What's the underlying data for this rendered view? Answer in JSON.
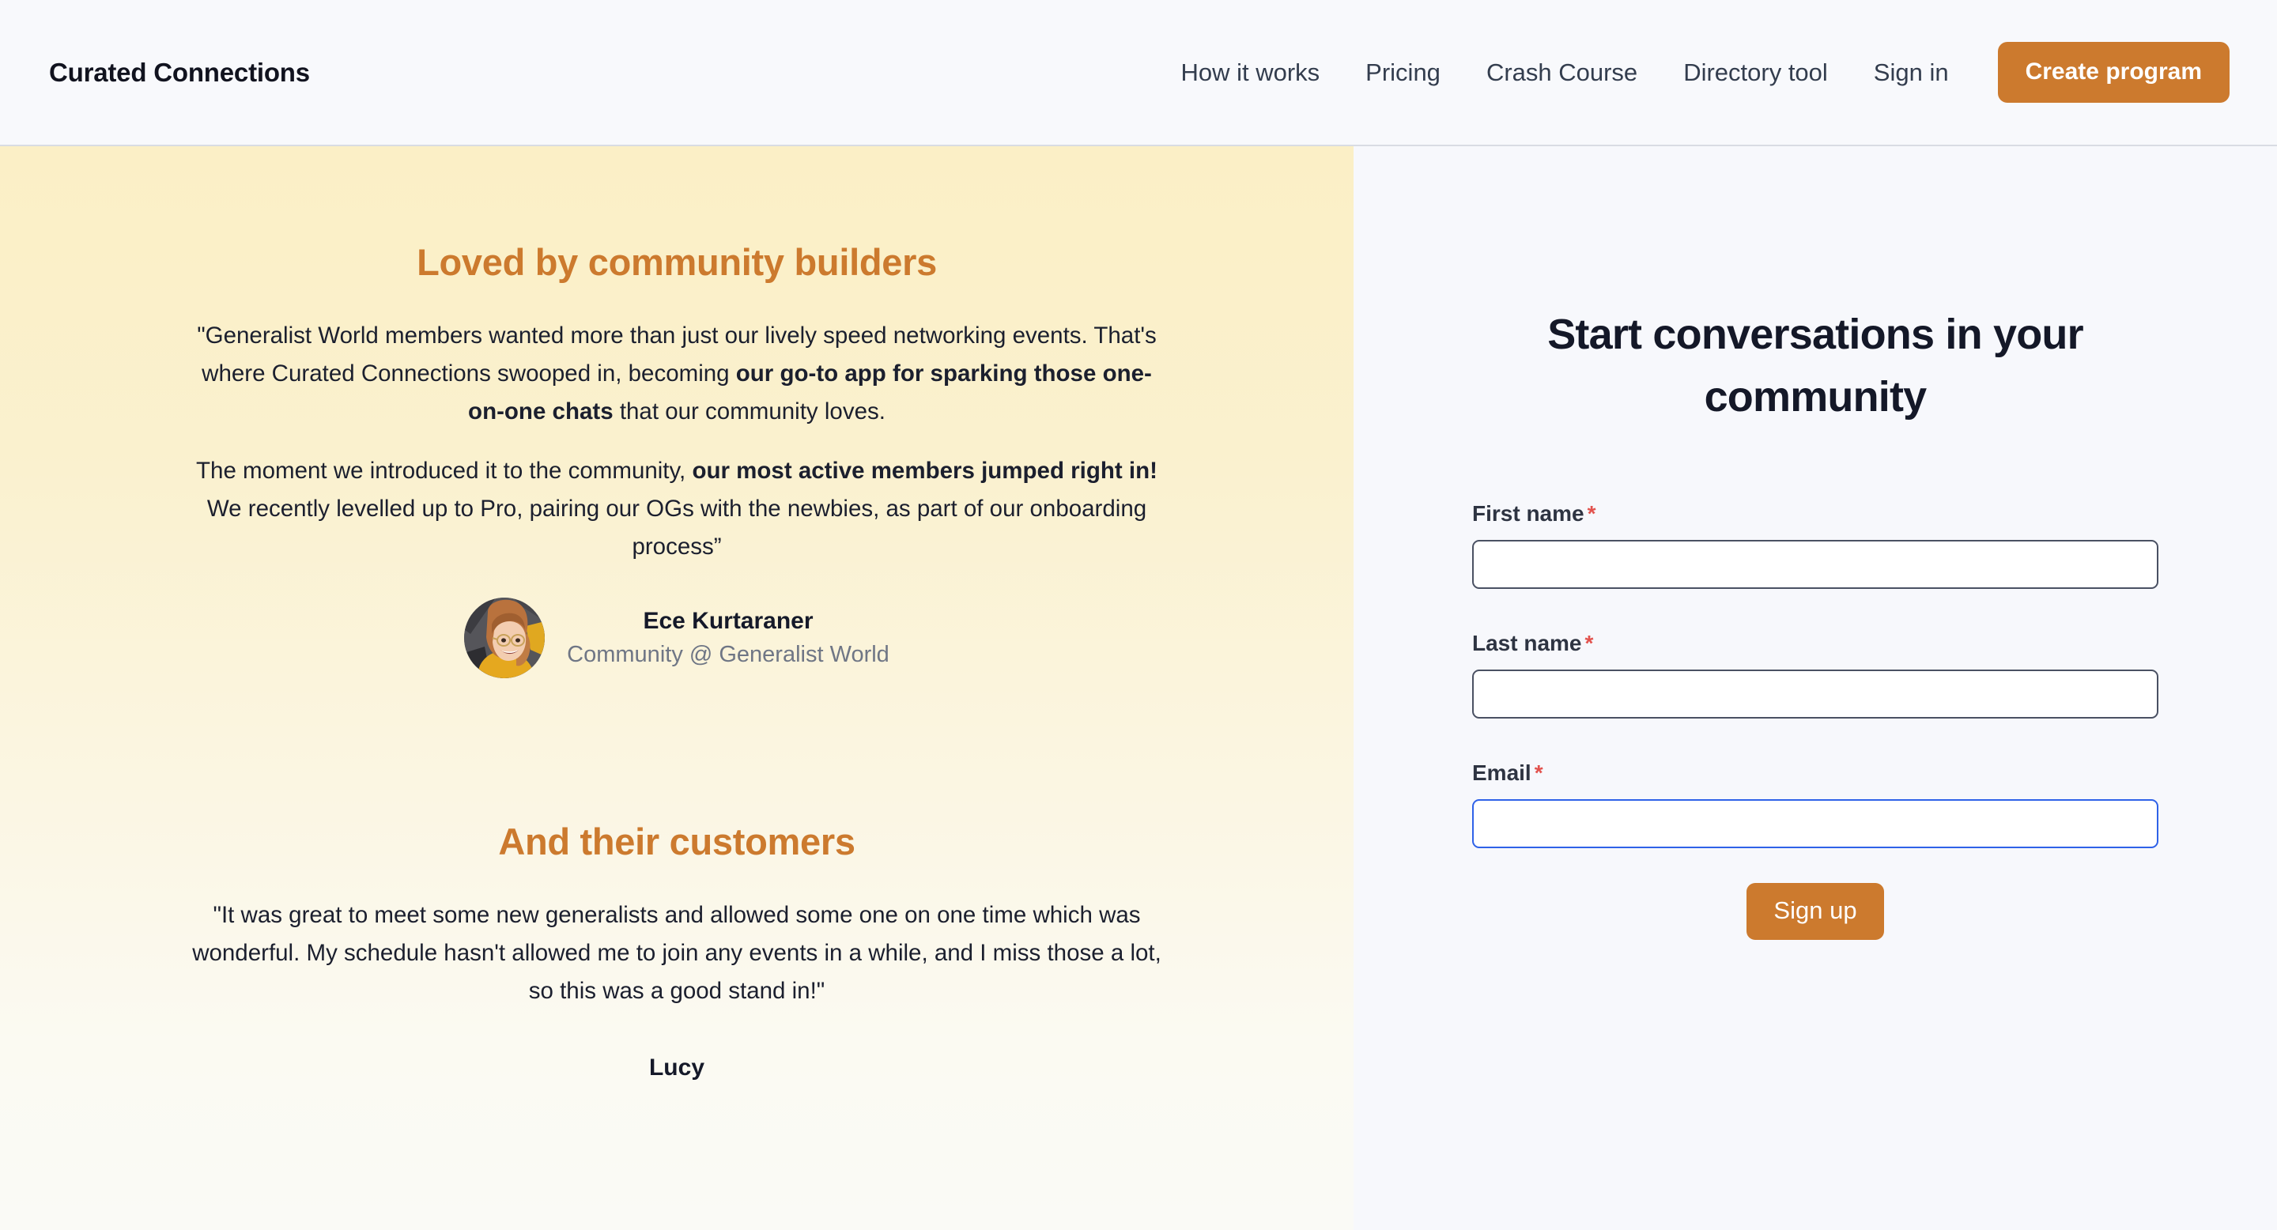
{
  "header": {
    "brand": "Curated Connections",
    "nav": [
      {
        "label": "How it works"
      },
      {
        "label": "Pricing"
      },
      {
        "label": "Crash Course"
      },
      {
        "label": "Directory tool"
      },
      {
        "label": "Sign in"
      }
    ],
    "cta_label": "Create program"
  },
  "testimonials": {
    "title": "Loved by community builders",
    "quote_p1_a": "\"Generalist World members wanted more than just our lively speed networking events. That's where Curated Connections swooped in, becoming ",
    "quote_p1_bold": "our go-to app for sparking those one-on-one chats",
    "quote_p1_b": " that our community loves.",
    "quote_p2_a": "The moment we introduced it to the community, ",
    "quote_p2_bold": "our most active members jumped right in!",
    "quote_p2_b": " We recently levelled up to Pro, pairing our OGs with the newbies, as part of our onboarding process”",
    "author_name": "Ece Kurtaraner",
    "author_role": "Community @ Generalist World",
    "avatar_name": "ece-kurtaraner-photo"
  },
  "customers": {
    "title": "And their customers",
    "quote": "\"It was great to meet some new generalists and allowed some one on one time which was wonderful. My schedule hasn't allowed me to join any events in a while, and I miss those a lot, so this was a good stand in!\"",
    "name": "Lucy"
  },
  "signup": {
    "title": "Start conversations in your community",
    "fields": [
      {
        "label": "First name",
        "required": "*",
        "value": "",
        "placeholder": ""
      },
      {
        "label": "Last name",
        "required": "*",
        "value": "",
        "placeholder": ""
      },
      {
        "label": "Email",
        "required": "*",
        "value": "",
        "placeholder": ""
      }
    ],
    "submit_label": "Sign up"
  },
  "colors": {
    "accent_orange": "#cc7a2e",
    "cream": "#fbefc6",
    "panel_bg": "#f7f8fc",
    "focus_blue": "#2f62e8",
    "required_red": "#e2524d",
    "text_dark": "#141828",
    "text_muted": "#6f7685"
  }
}
